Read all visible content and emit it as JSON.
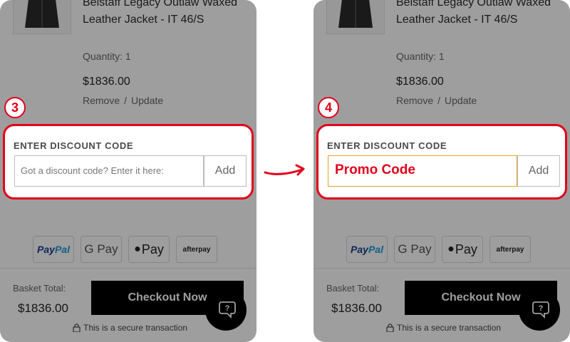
{
  "arrow_color": "#e3001b",
  "highlight_color": "#e3001b",
  "panels": [
    {
      "step": "3",
      "product": {
        "title": "Belstaff Legacy Outlaw Waxed Leather Jacket - IT 46/S",
        "quantity": "Quantity: 1",
        "price": "$1836.00",
        "remove": "Remove",
        "separator": "/",
        "update": "Update"
      },
      "discount": {
        "label": "ENTER DISCOUNT CODE",
        "placeholder": "Got a discount code? Enter it here:",
        "value": "",
        "add": "Add"
      },
      "payments": {
        "paypal_a": "Pay",
        "paypal_b": "Pal",
        "gpay": "G Pay",
        "applepay": "Pay",
        "afterpay": "afterpay"
      },
      "footer": {
        "basket_label": "Basket Total:",
        "basket_total": "$1836.00",
        "checkout": "Checkout Now",
        "secure": "This is a secure transaction"
      }
    },
    {
      "step": "4",
      "product": {
        "title": "Belstaff Legacy Outlaw Waxed Leather Jacket - IT 46/S",
        "quantity": "Quantity: 1",
        "price": "$1836.00",
        "remove": "Remove",
        "separator": "/",
        "update": "Update"
      },
      "discount": {
        "label": "ENTER DISCOUNT CODE",
        "placeholder": "",
        "value": "Promo Code",
        "add": "Add"
      },
      "payments": {
        "paypal_a": "Pay",
        "paypal_b": "Pal",
        "gpay": "G Pay",
        "applepay": "Pay",
        "afterpay": "afterpay"
      },
      "footer": {
        "basket_label": "Basket Total:",
        "basket_total": "$1836.00",
        "checkout": "Checkout Now",
        "secure": "This is a secure transaction"
      }
    }
  ]
}
